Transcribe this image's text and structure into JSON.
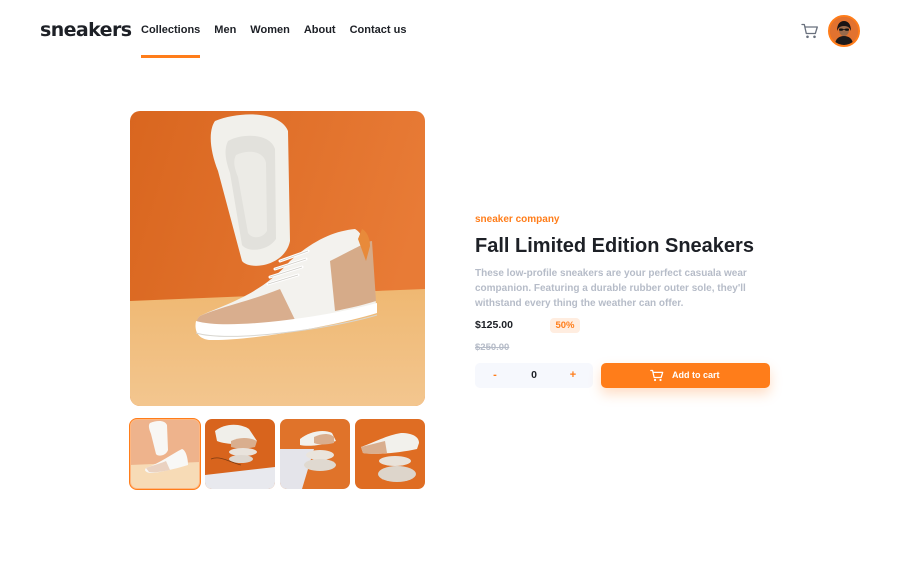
{
  "header": {
    "logo": "sneakers",
    "nav": [
      {
        "label": "Collections",
        "active": true
      },
      {
        "label": "Men"
      },
      {
        "label": "Women"
      },
      {
        "label": "About"
      },
      {
        "label": "Contact us"
      }
    ],
    "cart_icon": "cart-icon",
    "avatar_icon": "user-avatar"
  },
  "product": {
    "company": "sneaker company",
    "title": "Fall Limited Edition Sneakers",
    "description": "These low-profile sneakers are your perfect casuala wear companion. Featuring a durable rubber outer sole, they'll withstand every thing the weather can offer.",
    "price": "$125.00",
    "discount": "50%",
    "original_price": "$250.00",
    "images": [
      "product-image-1",
      "product-image-2",
      "product-image-3",
      "product-image-4"
    ],
    "selected_image": 1
  },
  "cart_controls": {
    "minus": "-",
    "quantity": "0",
    "plus": "+",
    "add_label": "Add to cart"
  },
  "colors": {
    "accent": "#ff7d1a",
    "accent_pale": "#ffede0",
    "text_dark": "#1d2026",
    "text_muted": "#b6bcc8"
  }
}
